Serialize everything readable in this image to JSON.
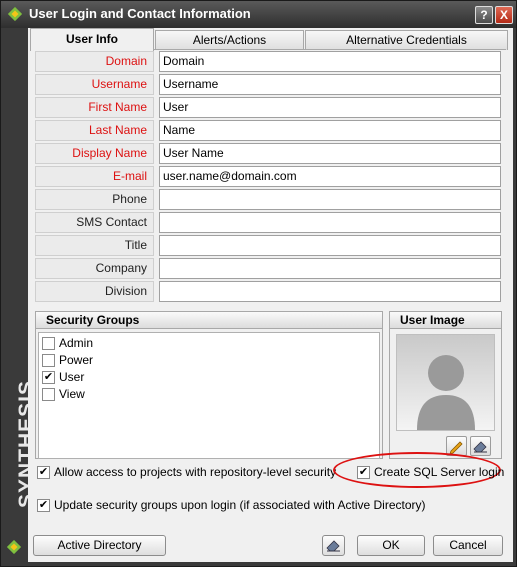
{
  "window": {
    "title": "User Login and Contact Information",
    "help_label": "?",
    "close_label": "X",
    "brand": "SYNTHESIS"
  },
  "tabs": [
    {
      "label": "User Info",
      "active": true
    },
    {
      "label": "Alerts/Actions",
      "active": false
    },
    {
      "label": "Alternative Credentials",
      "active": false
    }
  ],
  "fields": [
    {
      "label": "Domain",
      "value": "Domain",
      "required": true
    },
    {
      "label": "Username",
      "value": "Username",
      "required": true
    },
    {
      "label": "First Name",
      "value": "User",
      "required": true
    },
    {
      "label": "Last Name",
      "value": "Name",
      "required": true
    },
    {
      "label": "Display Name",
      "value": "User Name",
      "required": true
    },
    {
      "label": "E-mail",
      "value": "user.name@domain.com",
      "required": true
    },
    {
      "label": "Phone",
      "value": "",
      "required": false
    },
    {
      "label": "SMS Contact",
      "value": "",
      "required": false
    },
    {
      "label": "Title",
      "value": "",
      "required": false
    },
    {
      "label": "Company",
      "value": "",
      "required": false
    },
    {
      "label": "Division",
      "value": "",
      "required": false
    }
  ],
  "security_groups": {
    "title": "Security Groups",
    "items": [
      {
        "label": "Admin",
        "checked": false
      },
      {
        "label": "Power",
        "checked": false
      },
      {
        "label": "User",
        "checked": true
      },
      {
        "label": "View",
        "checked": false
      }
    ]
  },
  "user_image": {
    "title": "User Image",
    "edit_icon": "pencil-icon",
    "clear_icon": "eraser-icon"
  },
  "options": {
    "allow_access": {
      "label": "Allow access to projects with repository-level security",
      "checked": true
    },
    "create_sql": {
      "label": "Create SQL Server login",
      "checked": true
    },
    "update_groups": {
      "label": "Update security groups upon login (if associated with Active Directory)",
      "checked": true
    }
  },
  "buttons": {
    "active_directory": "Active Directory",
    "ok": "OK",
    "cancel": "Cancel"
  },
  "check_mark": "✔",
  "colors": {
    "required_label": "#dd1111",
    "highlight_ellipse": "#dd1111",
    "title_bar": "#3a3a3a",
    "close_button": "#c43a25"
  }
}
